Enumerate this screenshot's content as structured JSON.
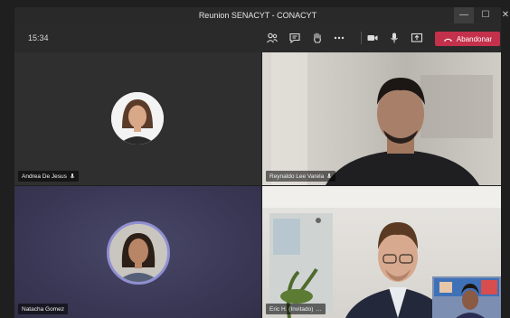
{
  "window": {
    "title": "Reunion SENACYT - CONACYT",
    "minimize_icon": "minimize-icon",
    "maximize_icon": "maximize-icon",
    "close_icon": "close-icon"
  },
  "toolbar": {
    "time": "15:34",
    "icons": [
      "participants-icon",
      "chat-icon",
      "raise-hand-icon",
      "more-icon",
      "camera-icon",
      "mic-icon",
      "share-screen-icon"
    ],
    "leave_label": "Abandonar",
    "leave_color": "#c4314b"
  },
  "participants": [
    {
      "name": "Andrea De Jesus"
    },
    {
      "name": "Reynaldo Lee Varela"
    },
    {
      "name": "Natacha Gomez"
    },
    {
      "name": "Eric H. (Invitado)",
      "name_suffix": "…"
    }
  ]
}
